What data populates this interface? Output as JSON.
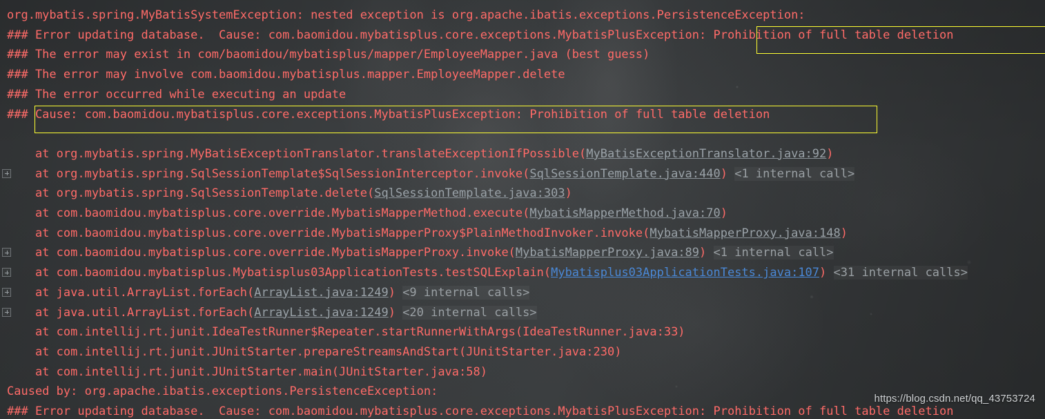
{
  "console": {
    "background_color": "#3b3e40",
    "error_text_color": "#ff6b68",
    "library_link_color": "#9aa2a8",
    "source_link_color": "#4a88d6",
    "internal_calls_color": "#9aa0a4",
    "highlight_border_color": "#ffff33"
  },
  "highlights": [
    {
      "name": "highlight-box-1",
      "text": "Prohibition of full table deletion"
    },
    {
      "name": "highlight-box-2",
      "text": "Cause: com.baomidou.mybatisplus.core.exceptions.MybatisPlusException: Prohibition of full table deletion"
    }
  ],
  "watermark": "https://blog.csdn.net/qq_43753724",
  "fold_icon_label": "+",
  "lines": [
    {
      "id": 0,
      "fold": false,
      "segments": [
        {
          "t": "org.mybatis.spring.MyBatisSystemException: nested exception is org.apache.ibatis.exceptions.PersistenceException:",
          "k": "err"
        }
      ]
    },
    {
      "id": 1,
      "fold": false,
      "segments": [
        {
          "t": "### Error updating database.  Cause: com.baomidou.mybatisplus.core.exceptions.MybatisPlusException: Prohibition of full table deletion",
          "k": "err"
        }
      ]
    },
    {
      "id": 2,
      "fold": false,
      "segments": [
        {
          "t": "### The error may exist in com/baomidou/mybatisplus/mapper/EmployeeMapper.java (best guess)",
          "k": "err"
        }
      ]
    },
    {
      "id": 3,
      "fold": false,
      "segments": [
        {
          "t": "### The error may involve com.baomidou.mybatisplus.mapper.EmployeeMapper.delete",
          "k": "err"
        }
      ]
    },
    {
      "id": 4,
      "fold": false,
      "segments": [
        {
          "t": "### The error occurred while executing an update",
          "k": "err"
        }
      ]
    },
    {
      "id": 5,
      "fold": false,
      "segments": [
        {
          "t": "### Cause: com.baomidou.mybatisplus.core.exceptions.MybatisPlusException: Prohibition of full table deletion",
          "k": "err"
        }
      ]
    },
    {
      "id": 6,
      "fold": false,
      "segments": [
        {
          "t": "",
          "k": "err"
        }
      ]
    },
    {
      "id": 7,
      "fold": false,
      "segments": [
        {
          "t": "\tat org.mybatis.spring.MyBatisExceptionTranslator.translateExceptionIfPossible(",
          "k": "err"
        },
        {
          "t": "MyBatisExceptionTranslator.java:92",
          "k": "lib-link"
        },
        {
          "t": ")",
          "k": "err"
        }
      ]
    },
    {
      "id": 8,
      "fold": true,
      "segments": [
        {
          "t": "\tat org.mybatis.spring.SqlSessionTemplate$SqlSessionInterceptor.invoke(",
          "k": "err"
        },
        {
          "t": "SqlSessionTemplate.java:440",
          "k": "lib-link"
        },
        {
          "t": ") ",
          "k": "err"
        },
        {
          "t": "<1 internal call>",
          "k": "internal"
        }
      ]
    },
    {
      "id": 9,
      "fold": false,
      "segments": [
        {
          "t": "\tat org.mybatis.spring.SqlSessionTemplate.delete(",
          "k": "err"
        },
        {
          "t": "SqlSessionTemplate.java:303",
          "k": "lib-link"
        },
        {
          "t": ")",
          "k": "err"
        }
      ]
    },
    {
      "id": 10,
      "fold": false,
      "segments": [
        {
          "t": "\tat com.baomidou.mybatisplus.core.override.MybatisMapperMethod.execute(",
          "k": "err"
        },
        {
          "t": "MybatisMapperMethod.java:70",
          "k": "lib-link"
        },
        {
          "t": ")",
          "k": "err"
        }
      ]
    },
    {
      "id": 11,
      "fold": false,
      "segments": [
        {
          "t": "\tat com.baomidou.mybatisplus.core.override.MybatisMapperProxy$PlainMethodInvoker.invoke(",
          "k": "err"
        },
        {
          "t": "MybatisMapperProxy.java:148",
          "k": "lib-link"
        },
        {
          "t": ")",
          "k": "err"
        }
      ]
    },
    {
      "id": 12,
      "fold": true,
      "segments": [
        {
          "t": "\tat com.baomidou.mybatisplus.core.override.MybatisMapperProxy.invoke(",
          "k": "err"
        },
        {
          "t": "MybatisMapperProxy.java:89",
          "k": "lib-link"
        },
        {
          "t": ") ",
          "k": "err"
        },
        {
          "t": "<1 internal call>",
          "k": "internal"
        }
      ]
    },
    {
      "id": 13,
      "fold": true,
      "segments": [
        {
          "t": "\tat com.baomidou.mybatisplus.Mybatisplus03ApplicationTests.testSQLExplain(",
          "k": "err"
        },
        {
          "t": "Mybatisplus03ApplicationTests.java:107",
          "k": "src-link"
        },
        {
          "t": ") ",
          "k": "err"
        },
        {
          "t": "<31 internal calls>",
          "k": "internal"
        }
      ]
    },
    {
      "id": 14,
      "fold": true,
      "segments": [
        {
          "t": "\tat java.util.ArrayList.forEach(",
          "k": "err"
        },
        {
          "t": "ArrayList.java:1249",
          "k": "lib-link"
        },
        {
          "t": ") ",
          "k": "err"
        },
        {
          "t": "<9 internal calls>",
          "k": "internal"
        }
      ]
    },
    {
      "id": 15,
      "fold": true,
      "segments": [
        {
          "t": "\tat java.util.ArrayList.forEach(",
          "k": "err"
        },
        {
          "t": "ArrayList.java:1249",
          "k": "lib-link"
        },
        {
          "t": ") ",
          "k": "err"
        },
        {
          "t": "<20 internal calls>",
          "k": "internal"
        }
      ]
    },
    {
      "id": 16,
      "fold": false,
      "segments": [
        {
          "t": "\tat com.intellij.rt.junit.IdeaTestRunner$Repeater.startRunnerWithArgs(IdeaTestRunner.java:33)",
          "k": "err"
        }
      ]
    },
    {
      "id": 17,
      "fold": false,
      "segments": [
        {
          "t": "\tat com.intellij.rt.junit.JUnitStarter.prepareStreamsAndStart(JUnitStarter.java:230)",
          "k": "err"
        }
      ]
    },
    {
      "id": 18,
      "fold": false,
      "segments": [
        {
          "t": "\tat com.intellij.rt.junit.JUnitStarter.main(JUnitStarter.java:58)",
          "k": "err"
        }
      ]
    },
    {
      "id": 19,
      "fold": false,
      "segments": [
        {
          "t": "Caused by: org.apache.ibatis.exceptions.PersistenceException:",
          "k": "err"
        }
      ]
    },
    {
      "id": 20,
      "fold": false,
      "segments": [
        {
          "t": "### Error updating database.  Cause: com.baomidou.mybatisplus.core.exceptions.MybatisPlusException: Prohibition of full table deletion",
          "k": "err"
        }
      ]
    }
  ]
}
